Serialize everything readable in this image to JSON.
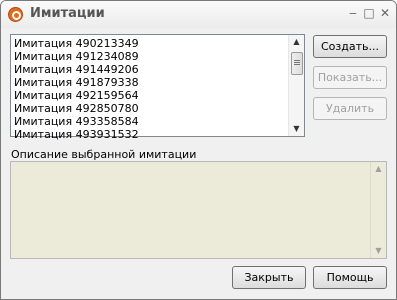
{
  "window": {
    "title": "Имитации",
    "min_glyph": "‒",
    "max_glyph": "□",
    "close_glyph": "✕"
  },
  "list": {
    "items": [
      "Имитация 490213349",
      "Имитация 491234089",
      "Имитация 491449206",
      "Имитация 491879338",
      "Имитация 492159564",
      "Имитация 492850780",
      "Имитация 493358584",
      "Имитация 493931532"
    ]
  },
  "buttons": {
    "create": "Создать...",
    "show": "Показать...",
    "delete": "Удалить",
    "close": "Закрыть",
    "help": "Помощь"
  },
  "description": {
    "label": "Описание выбранной имитации",
    "text": ""
  },
  "icons": {
    "app": "app-icon",
    "scroll_up": "▲",
    "scroll_down": "▼"
  }
}
